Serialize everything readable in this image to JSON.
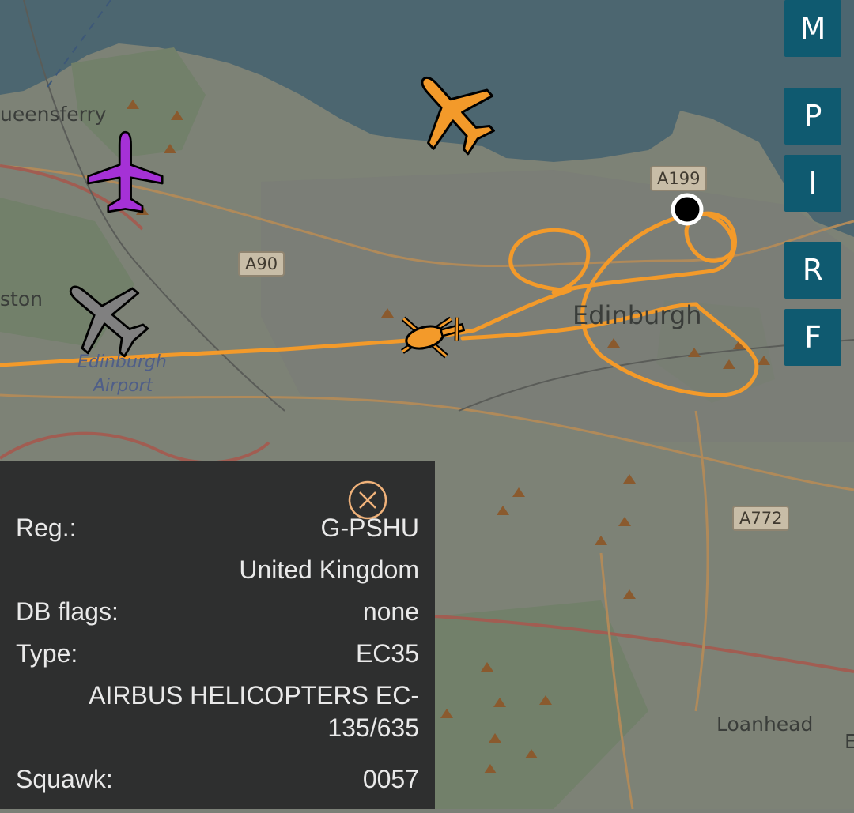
{
  "map": {
    "places": {
      "queensferry": "ueensferry",
      "kirkliston": "ston",
      "airport_line1": "Edinburgh",
      "airport_line2": "Airport",
      "edinburgh": "Edinburgh",
      "loanhead": "Loanhead",
      "edge_letter": "E"
    },
    "roads": {
      "a199": "A199",
      "a90": "A90",
      "a772": "A772"
    },
    "colors": {
      "sea": "#4c6670",
      "land": "#7d8276",
      "track": "#f39a2a",
      "selected_aircraft": "#f39a2a",
      "purple_aircraft": "#a531d6",
      "grey_aircraft": "#808080"
    },
    "icons": [
      "airliner-icon",
      "helicopter-icon",
      "aircraft-icon",
      "close-icon"
    ]
  },
  "side_buttons": [
    {
      "label": "M"
    },
    {
      "label": "P"
    },
    {
      "label": "I"
    },
    {
      "label": "R"
    },
    {
      "label": "F"
    }
  ],
  "info": {
    "reg_label": "Reg.:",
    "reg_value": "G-PSHU",
    "country": "United Kingdom",
    "dbflags_label": "DB flags:",
    "dbflags_value": "none",
    "type_label": "Type:",
    "type_value": "EC35",
    "type_desc_line1": "AIRBUS HELICOPTERS EC-",
    "type_desc_line2": "135/635",
    "squawk_label": "Squawk:",
    "squawk_value": "0057"
  }
}
